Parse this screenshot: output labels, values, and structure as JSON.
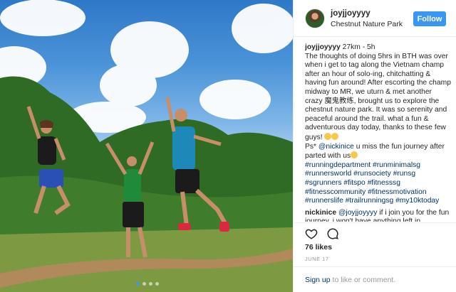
{
  "post": {
    "photo_alt": "",
    "carousel_dots": 4,
    "carousel_active": 1
  },
  "header": {
    "username": "joyjjoyyyy",
    "location": "Chestnut Nature Park",
    "follow_label": "Follow",
    "avatar": "avatar"
  },
  "caption": {
    "username": "joyjjoyyyy",
    "text_1": " 27km - 5h",
    "text_2": "The thoughts of doing 5hrs in BTH was over when i get to tag along the Vietnam champ after an hour of solo-ing, chitchatting & having fun around! After escorting the champ midway to MR, we uturn & met another crazy 魔鬼教练, brought us to explore the chestnut nature park. It was so serenity and peaceful around the trail. what a fun & adventurous day today, thanks to these few guys! ",
    "text_3": "Ps* ",
    "mention": "@nickinice",
    "text_4": " u miss the fun journey after parted with us",
    "hashtags": "#runningdepartment #runminimalsg #runnersworld #runsociety #runsg #sgrunners #fitspo #fitnesssg #fitnesscommunity #fitnessmotivation #runnerslife #trailrunningsg #my10ktoday"
  },
  "comment": {
    "username": "nickinice",
    "mention": "@joyjjoyyyy",
    "text": " if i join you for the fun journey, i won't have anything left in"
  },
  "actions": {
    "like_icon": "heart-icon",
    "comment_icon": "comment-icon"
  },
  "likes": "76 likes",
  "date": "JUNE 17",
  "signup": {
    "link": "Sign up",
    "text": " to like or comment."
  },
  "colors": {
    "accent": "#3897f0",
    "link": "#003569"
  }
}
